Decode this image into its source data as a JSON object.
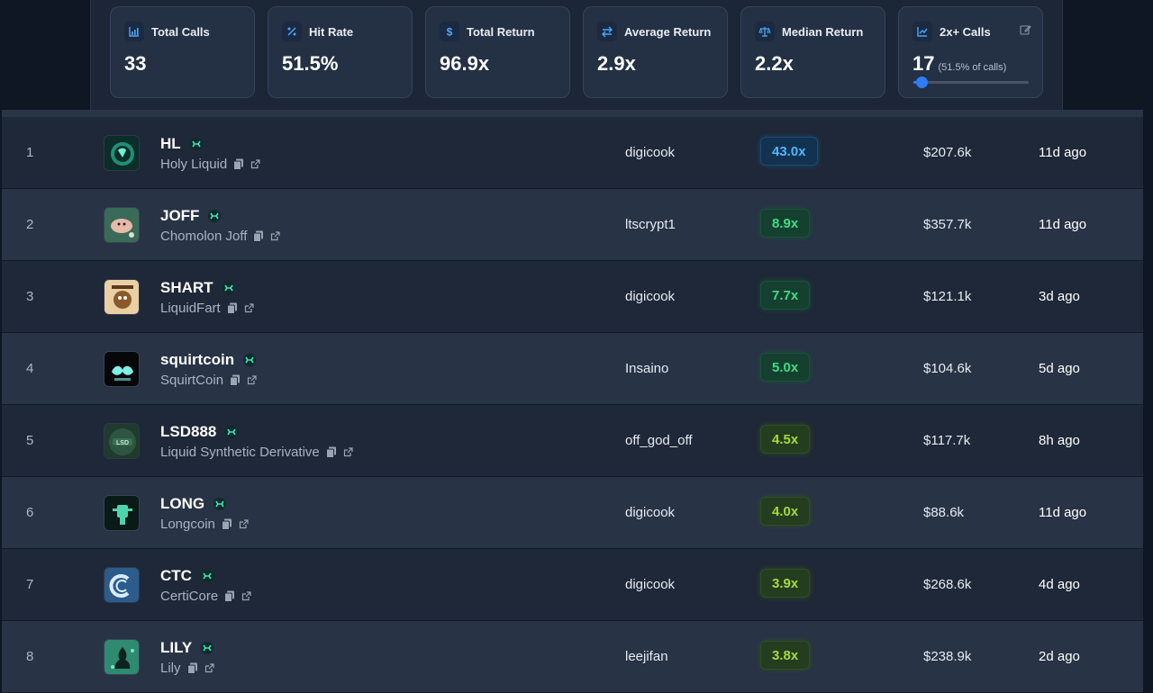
{
  "stats": [
    {
      "label": "Total Calls",
      "value": "33",
      "icon": "bar-chart-icon"
    },
    {
      "label": "Hit Rate",
      "value": "51.5%",
      "icon": "percent-icon"
    },
    {
      "label": "Total Return",
      "value": "96.9x",
      "icon": "dollar-icon"
    },
    {
      "label": "Average Return",
      "value": "2.9x",
      "icon": "swap-arrows-icon"
    },
    {
      "label": "Median Return",
      "value": "2.2x",
      "icon": "balance-scale-icon"
    },
    {
      "label": "2x+ Calls",
      "value": "17",
      "sub": "(51.5% of calls)",
      "icon": "trend-chart-icon",
      "edit_icon": "edit-icon",
      "slider_fraction": 0.07
    }
  ],
  "colors": {
    "accent": "#3b82f6",
    "mult_blue": "#4db8ff",
    "mult_green": "#3ddc84",
    "mult_lime": "#a6d93b"
  },
  "rows": [
    {
      "rank": "1",
      "symbol": "HL",
      "name": "Holy Liquid",
      "caller": "digicook",
      "mult": "43.0x",
      "mult_style": "blue",
      "mcap": "$207.6k",
      "ago": "11d ago"
    },
    {
      "rank": "2",
      "symbol": "JOFF",
      "name": "Chomolon Joff",
      "caller": "ltscrypt1",
      "mult": "8.9x",
      "mult_style": "green",
      "mcap": "$357.7k",
      "ago": "11d ago"
    },
    {
      "rank": "3",
      "symbol": "SHART",
      "name": "LiquidFart",
      "caller": "digicook",
      "mult": "7.7x",
      "mult_style": "green",
      "mcap": "$121.1k",
      "ago": "3d ago"
    },
    {
      "rank": "4",
      "symbol": "squirtcoin",
      "name": "SquirtCoin",
      "caller": "Insaino",
      "mult": "5.0x",
      "mult_style": "green",
      "mcap": "$104.6k",
      "ago": "5d ago"
    },
    {
      "rank": "5",
      "symbol": "LSD888",
      "name": "Liquid Synthetic Derivative",
      "caller": "off_god_off",
      "mult": "4.5x",
      "mult_style": "lime",
      "mcap": "$117.7k",
      "ago": "8h ago"
    },
    {
      "rank": "6",
      "symbol": "LONG",
      "name": "Longcoin",
      "caller": "digicook",
      "mult": "4.0x",
      "mult_style": "lime",
      "mcap": "$88.6k",
      "ago": "11d ago"
    },
    {
      "rank": "7",
      "symbol": "CTC",
      "name": "CertiCore",
      "caller": "digicook",
      "mult": "3.9x",
      "mult_style": "lime",
      "mcap": "$268.6k",
      "ago": "4d ago"
    },
    {
      "rank": "8",
      "symbol": "LILY",
      "name": "Lily",
      "caller": "leejifan",
      "mult": "3.8x",
      "mult_style": "lime",
      "mcap": "$238.9k",
      "ago": "2d ago"
    }
  ]
}
